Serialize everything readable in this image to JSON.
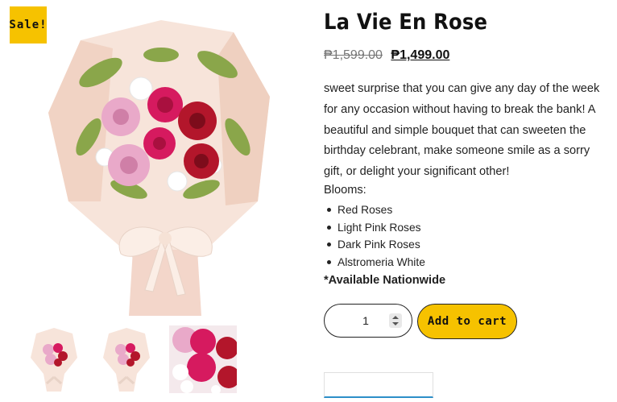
{
  "badge": {
    "label": "Sale!"
  },
  "product": {
    "title": "La Vie En Rose",
    "old_price": "₱1,599.00",
    "new_price": "₱1,499.00",
    "description": "sweet surprise that you can give any day of the week for any occasion without having to break the bank! A beautiful and simple bouquet that can sweeten the birthday celebrant, make someone smile as a sorry gift, or delight your significant other!",
    "blooms_label": "Blooms:",
    "blooms": [
      "Red Roses",
      "Light Pink Roses",
      "Dark Pink Roses",
      "Alstromeria White"
    ],
    "availability": "*Available Nationwide"
  },
  "cart": {
    "quantity": "1",
    "add_label": "Add to cart"
  },
  "colors": {
    "accent": "#f6c200",
    "red_rose": "#b3162b",
    "dark_pink_rose": "#d61a5f",
    "light_pink_rose": "#e9a9c9",
    "wrap": "#f6ddd0"
  },
  "images": {
    "main": "bouquet-photo",
    "thumbnails": [
      "bouquet-thumb",
      "bouquet-thumb",
      "roses-closeup-thumb"
    ]
  }
}
